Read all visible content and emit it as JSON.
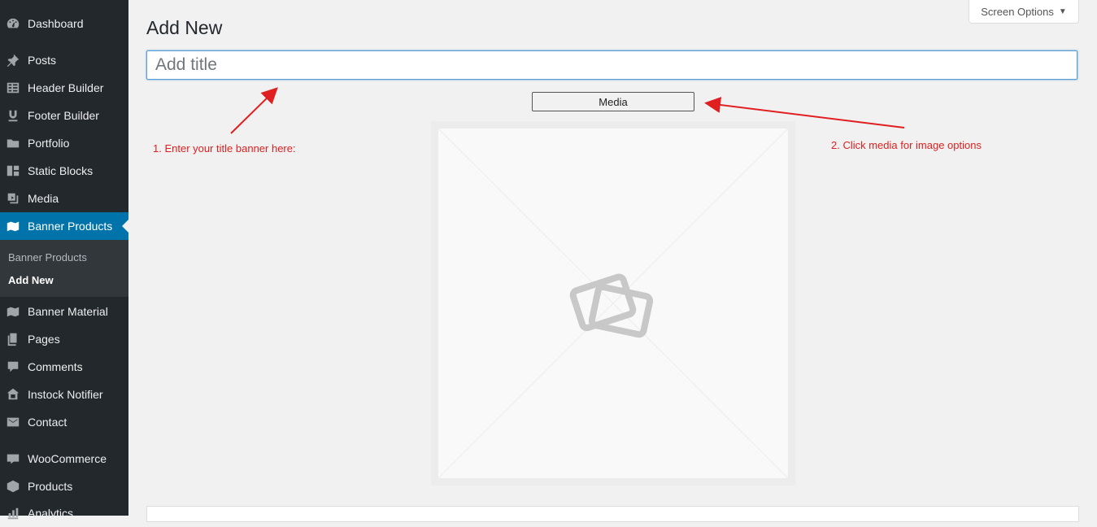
{
  "sidebar": {
    "items": [
      {
        "label": "Dashboard",
        "icon": "dashboard-icon"
      },
      {
        "label": "Posts",
        "icon": "pin-icon"
      },
      {
        "label": "Header Builder",
        "icon": "table-icon"
      },
      {
        "label": "Footer Builder",
        "icon": "underline-icon"
      },
      {
        "label": "Portfolio",
        "icon": "folder-icon"
      },
      {
        "label": "Static Blocks",
        "icon": "blocks-icon"
      },
      {
        "label": "Media",
        "icon": "media-icon"
      },
      {
        "label": "Banner Products",
        "icon": "map-icon"
      },
      {
        "label": "Banner Material",
        "icon": "map-icon"
      },
      {
        "label": "Pages",
        "icon": "pages-icon"
      },
      {
        "label": "Comments",
        "icon": "comment-icon"
      },
      {
        "label": "Instock Notifier",
        "icon": "store-icon"
      },
      {
        "label": "Contact",
        "icon": "envelope-icon"
      },
      {
        "label": "WooCommerce",
        "icon": "woo-icon"
      },
      {
        "label": "Products",
        "icon": "box-icon"
      },
      {
        "label": "Analytics",
        "icon": "chart-icon"
      }
    ],
    "submenu": [
      {
        "label": "Banner Products"
      },
      {
        "label": "Add New"
      }
    ]
  },
  "header": {
    "title": "Add New",
    "screen_options": "Screen Options"
  },
  "editor": {
    "title_placeholder": "Add title",
    "media_button": "Media"
  },
  "annotations": {
    "title_hint": "1. Enter your title banner here:",
    "media_hint": "2. Click media for image options"
  },
  "colors": {
    "sidebar_bg": "#23282d",
    "active_bg": "#0073aa",
    "annotation": "#e02020"
  }
}
